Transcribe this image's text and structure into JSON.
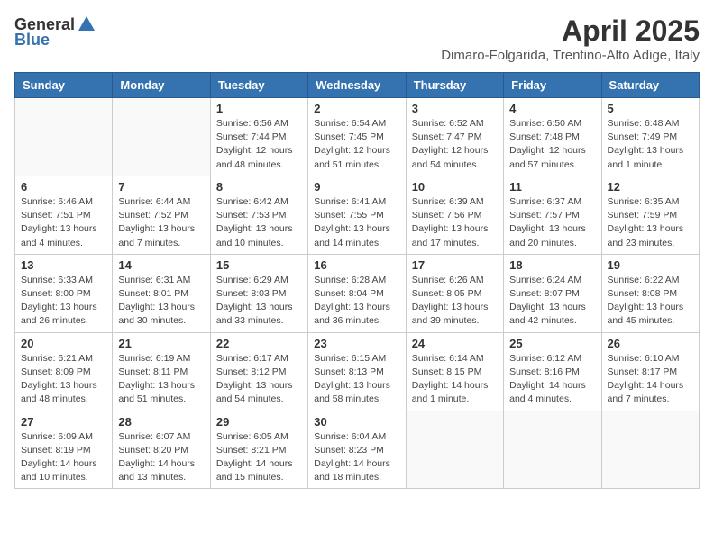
{
  "header": {
    "logo_general": "General",
    "logo_blue": "Blue",
    "month_title": "April 2025",
    "location": "Dimaro-Folgarida, Trentino-Alto Adige, Italy"
  },
  "weekdays": [
    "Sunday",
    "Monday",
    "Tuesday",
    "Wednesday",
    "Thursday",
    "Friday",
    "Saturday"
  ],
  "weeks": [
    [
      {
        "day": "",
        "info": ""
      },
      {
        "day": "",
        "info": ""
      },
      {
        "day": "1",
        "info": "Sunrise: 6:56 AM\nSunset: 7:44 PM\nDaylight: 12 hours and 48 minutes."
      },
      {
        "day": "2",
        "info": "Sunrise: 6:54 AM\nSunset: 7:45 PM\nDaylight: 12 hours and 51 minutes."
      },
      {
        "day": "3",
        "info": "Sunrise: 6:52 AM\nSunset: 7:47 PM\nDaylight: 12 hours and 54 minutes."
      },
      {
        "day": "4",
        "info": "Sunrise: 6:50 AM\nSunset: 7:48 PM\nDaylight: 12 hours and 57 minutes."
      },
      {
        "day": "5",
        "info": "Sunrise: 6:48 AM\nSunset: 7:49 PM\nDaylight: 13 hours and 1 minute."
      }
    ],
    [
      {
        "day": "6",
        "info": "Sunrise: 6:46 AM\nSunset: 7:51 PM\nDaylight: 13 hours and 4 minutes."
      },
      {
        "day": "7",
        "info": "Sunrise: 6:44 AM\nSunset: 7:52 PM\nDaylight: 13 hours and 7 minutes."
      },
      {
        "day": "8",
        "info": "Sunrise: 6:42 AM\nSunset: 7:53 PM\nDaylight: 13 hours and 10 minutes."
      },
      {
        "day": "9",
        "info": "Sunrise: 6:41 AM\nSunset: 7:55 PM\nDaylight: 13 hours and 14 minutes."
      },
      {
        "day": "10",
        "info": "Sunrise: 6:39 AM\nSunset: 7:56 PM\nDaylight: 13 hours and 17 minutes."
      },
      {
        "day": "11",
        "info": "Sunrise: 6:37 AM\nSunset: 7:57 PM\nDaylight: 13 hours and 20 minutes."
      },
      {
        "day": "12",
        "info": "Sunrise: 6:35 AM\nSunset: 7:59 PM\nDaylight: 13 hours and 23 minutes."
      }
    ],
    [
      {
        "day": "13",
        "info": "Sunrise: 6:33 AM\nSunset: 8:00 PM\nDaylight: 13 hours and 26 minutes."
      },
      {
        "day": "14",
        "info": "Sunrise: 6:31 AM\nSunset: 8:01 PM\nDaylight: 13 hours and 30 minutes."
      },
      {
        "day": "15",
        "info": "Sunrise: 6:29 AM\nSunset: 8:03 PM\nDaylight: 13 hours and 33 minutes."
      },
      {
        "day": "16",
        "info": "Sunrise: 6:28 AM\nSunset: 8:04 PM\nDaylight: 13 hours and 36 minutes."
      },
      {
        "day": "17",
        "info": "Sunrise: 6:26 AM\nSunset: 8:05 PM\nDaylight: 13 hours and 39 minutes."
      },
      {
        "day": "18",
        "info": "Sunrise: 6:24 AM\nSunset: 8:07 PM\nDaylight: 13 hours and 42 minutes."
      },
      {
        "day": "19",
        "info": "Sunrise: 6:22 AM\nSunset: 8:08 PM\nDaylight: 13 hours and 45 minutes."
      }
    ],
    [
      {
        "day": "20",
        "info": "Sunrise: 6:21 AM\nSunset: 8:09 PM\nDaylight: 13 hours and 48 minutes."
      },
      {
        "day": "21",
        "info": "Sunrise: 6:19 AM\nSunset: 8:11 PM\nDaylight: 13 hours and 51 minutes."
      },
      {
        "day": "22",
        "info": "Sunrise: 6:17 AM\nSunset: 8:12 PM\nDaylight: 13 hours and 54 minutes."
      },
      {
        "day": "23",
        "info": "Sunrise: 6:15 AM\nSunset: 8:13 PM\nDaylight: 13 hours and 58 minutes."
      },
      {
        "day": "24",
        "info": "Sunrise: 6:14 AM\nSunset: 8:15 PM\nDaylight: 14 hours and 1 minute."
      },
      {
        "day": "25",
        "info": "Sunrise: 6:12 AM\nSunset: 8:16 PM\nDaylight: 14 hours and 4 minutes."
      },
      {
        "day": "26",
        "info": "Sunrise: 6:10 AM\nSunset: 8:17 PM\nDaylight: 14 hours and 7 minutes."
      }
    ],
    [
      {
        "day": "27",
        "info": "Sunrise: 6:09 AM\nSunset: 8:19 PM\nDaylight: 14 hours and 10 minutes."
      },
      {
        "day": "28",
        "info": "Sunrise: 6:07 AM\nSunset: 8:20 PM\nDaylight: 14 hours and 13 minutes."
      },
      {
        "day": "29",
        "info": "Sunrise: 6:05 AM\nSunset: 8:21 PM\nDaylight: 14 hours and 15 minutes."
      },
      {
        "day": "30",
        "info": "Sunrise: 6:04 AM\nSunset: 8:23 PM\nDaylight: 14 hours and 18 minutes."
      },
      {
        "day": "",
        "info": ""
      },
      {
        "day": "",
        "info": ""
      },
      {
        "day": "",
        "info": ""
      }
    ]
  ]
}
